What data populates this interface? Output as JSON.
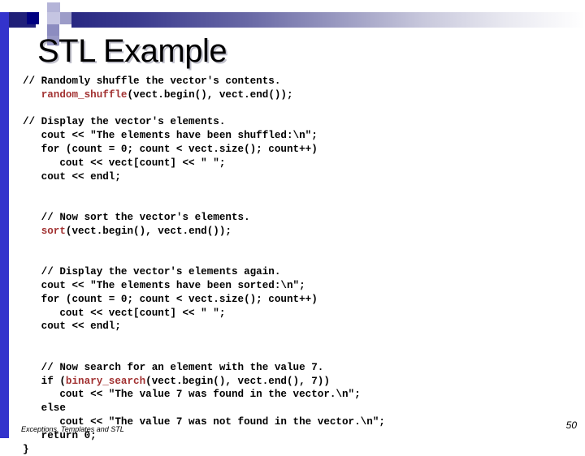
{
  "slide": {
    "title": "STL Example",
    "footer_text": "Exceptions, Templates and STL",
    "page_number": "50",
    "accent_color": "#3333cc",
    "band_dark_color": "#1f1f77",
    "keyword_color": "#a23232",
    "text_color": "#000000"
  },
  "code": {
    "lines": [
      {
        "id": "l01",
        "indent": 0,
        "segments": [
          {
            "text": "// Randomly shuffle the vector's contents."
          }
        ]
      },
      {
        "id": "l02",
        "indent": 0,
        "segments": [
          {
            "text": "   "
          },
          {
            "text": "random_shuffle",
            "style": "kw"
          },
          {
            "text": "(vect.begin(), vect.end());"
          }
        ]
      },
      {
        "id": "l03",
        "indent": 0,
        "blank": true,
        "segments": []
      },
      {
        "id": "l04",
        "indent": 0,
        "segments": [
          {
            "text": "// Display the vector's elements."
          }
        ]
      },
      {
        "id": "l05",
        "indent": 0,
        "segments": [
          {
            "text": "   cout << \"The elements have been shuffled:\\n\";"
          }
        ]
      },
      {
        "id": "l06",
        "indent": 0,
        "segments": [
          {
            "text": "   for (count = 0; count < vect.size(); count++)"
          }
        ]
      },
      {
        "id": "l07",
        "indent": 0,
        "segments": [
          {
            "text": "      cout << vect[count] << \" \";"
          }
        ]
      },
      {
        "id": "l08",
        "indent": 0,
        "segments": [
          {
            "text": "   cout << endl;"
          }
        ]
      },
      {
        "id": "l09",
        "indent": 0,
        "blank": true,
        "segments": []
      },
      {
        "id": "l10",
        "indent": 0,
        "blank": true,
        "segments": []
      },
      {
        "id": "l11",
        "indent": 0,
        "segments": [
          {
            "text": "   // Now sort the vector's elements."
          }
        ]
      },
      {
        "id": "l12",
        "indent": 0,
        "segments": [
          {
            "text": "   "
          },
          {
            "text": "sort",
            "style": "kw"
          },
          {
            "text": "(vect.begin(), vect.end());"
          }
        ]
      },
      {
        "id": "l13",
        "indent": 0,
        "blank": true,
        "segments": []
      },
      {
        "id": "l14",
        "indent": 0,
        "blank": true,
        "segments": []
      },
      {
        "id": "l15",
        "indent": 0,
        "segments": [
          {
            "text": "   // Display the vector's elements again."
          }
        ]
      },
      {
        "id": "l16",
        "indent": 0,
        "segments": [
          {
            "text": "   cout << \"The elements have been sorted:\\n\";"
          }
        ]
      },
      {
        "id": "l17",
        "indent": 0,
        "segments": [
          {
            "text": "   for (count = 0; count < vect.size(); count++)"
          }
        ]
      },
      {
        "id": "l18",
        "indent": 0,
        "segments": [
          {
            "text": "      cout << vect[count] << \" \";"
          }
        ]
      },
      {
        "id": "l19",
        "indent": 0,
        "segments": [
          {
            "text": "   cout << endl;"
          }
        ]
      },
      {
        "id": "l20",
        "indent": 0,
        "blank": true,
        "segments": []
      },
      {
        "id": "l21",
        "indent": 0,
        "blank": true,
        "segments": []
      },
      {
        "id": "l22",
        "indent": 0,
        "segments": [
          {
            "text": "   // Now search for an element with the value 7."
          }
        ]
      },
      {
        "id": "l23",
        "indent": 0,
        "segments": [
          {
            "text": "   if ("
          },
          {
            "text": "binary_search",
            "style": "kw"
          },
          {
            "text": "(vect.begin(), vect.end(), 7))"
          }
        ]
      },
      {
        "id": "l24",
        "indent": 0,
        "segments": [
          {
            "text": "      cout << \"The value 7 was found in the vector.\\n\";"
          }
        ]
      },
      {
        "id": "l25",
        "indent": 0,
        "segments": [
          {
            "text": "   else"
          }
        ]
      },
      {
        "id": "l26",
        "indent": 0,
        "segments": [
          {
            "text": "      cout << \"The value 7 was not found in the vector.\\n\";"
          }
        ]
      },
      {
        "id": "l27",
        "indent": 0,
        "segments": [
          {
            "text": "   return 0;"
          }
        ]
      },
      {
        "id": "l28",
        "indent": 0,
        "segments": [
          {
            "text": "}"
          }
        ]
      }
    ]
  }
}
